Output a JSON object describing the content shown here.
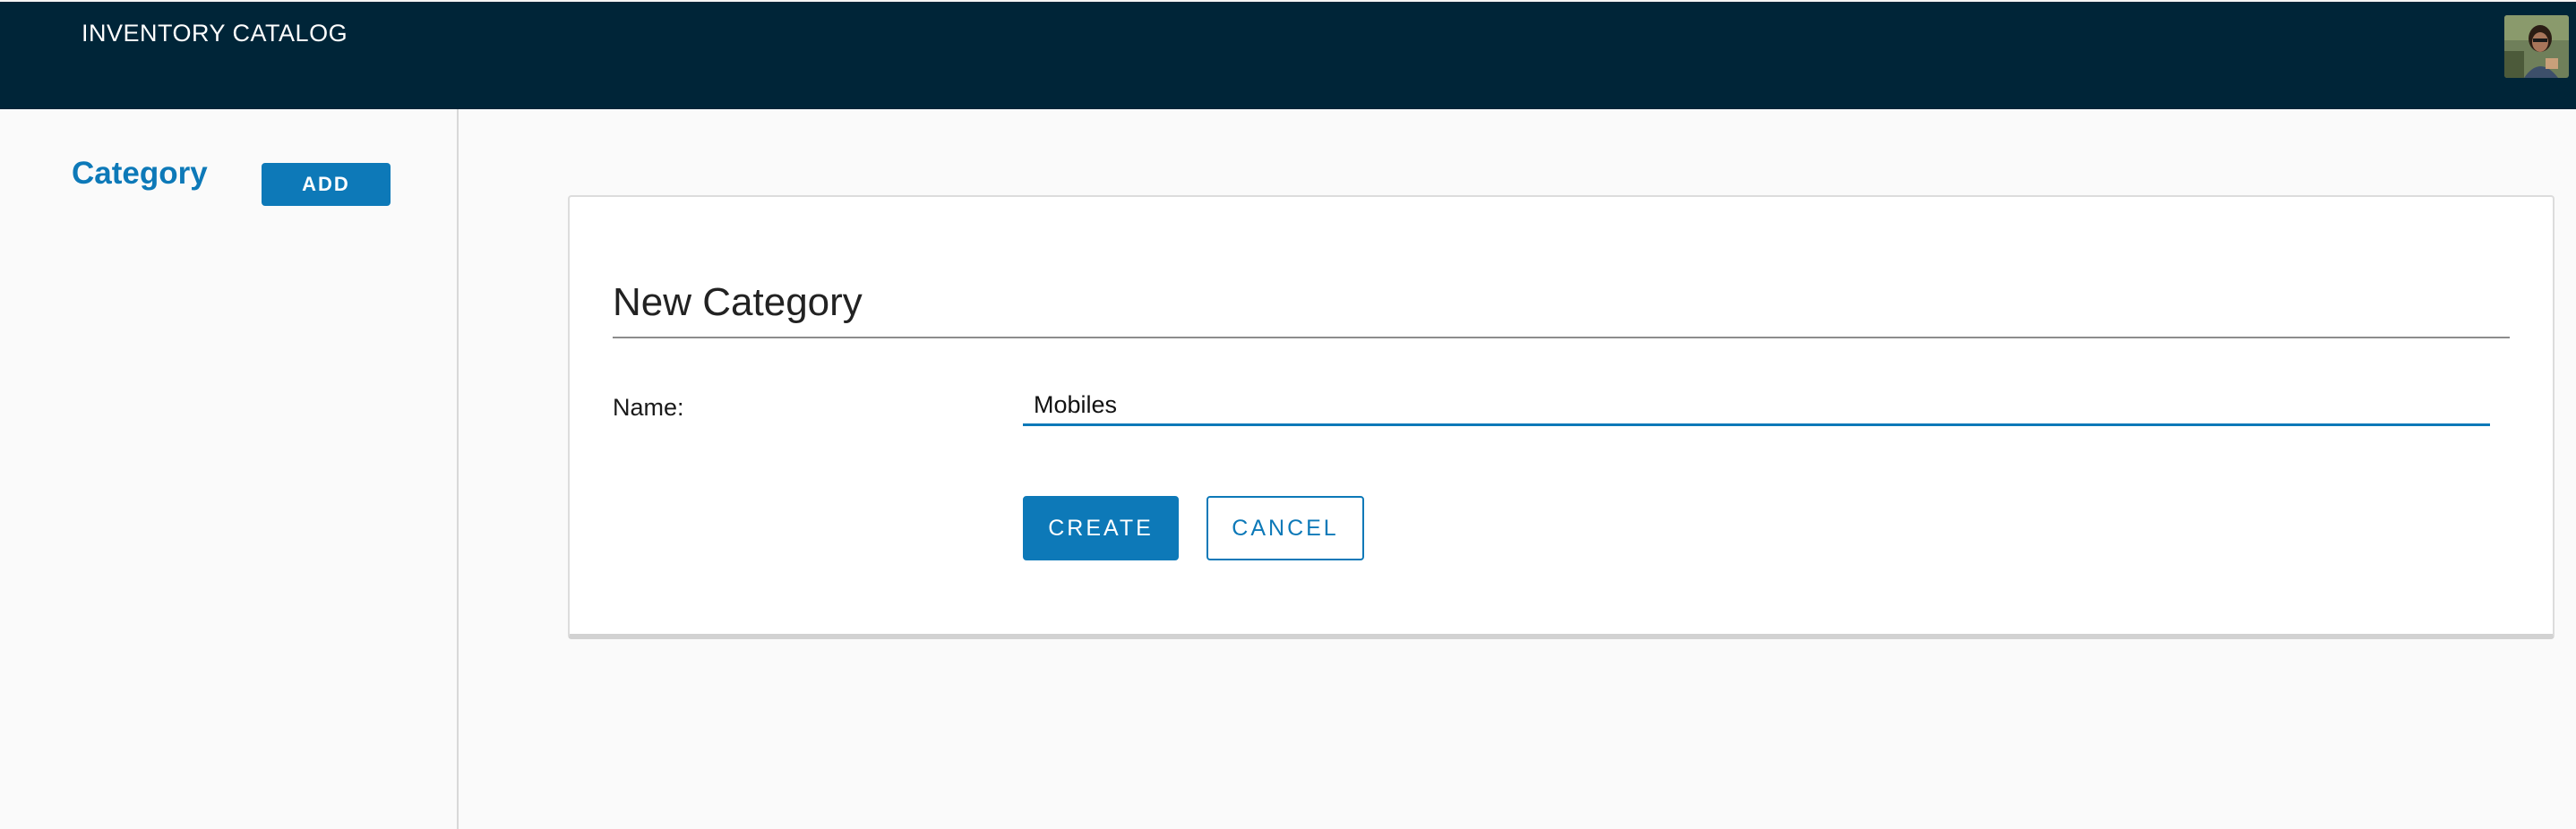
{
  "header": {
    "app_title": "INVENTORY CATALOG",
    "avatar_icon": "user-avatar-photo"
  },
  "sidebar": {
    "title": "Category",
    "add_label": "ADD"
  },
  "form": {
    "title": "New Category",
    "name_label": "Name:",
    "name_value": "Mobiles",
    "create_label": "CREATE",
    "cancel_label": "CANCEL"
  },
  "colors": {
    "header_bg": "#002538",
    "accent": "#0d79b8",
    "page_bg": "#fafafa"
  }
}
